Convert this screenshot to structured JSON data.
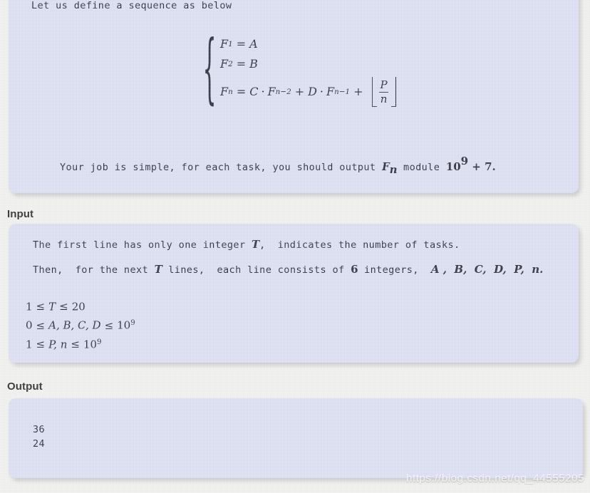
{
  "statement": {
    "intro": "Let us define a sequence as below",
    "formula": {
      "cases": [
        {
          "lhs": "F",
          "lhs_sub": "1",
          "eq": "=",
          "rhs": "A"
        },
        {
          "lhs": "F",
          "lhs_sub": "2",
          "eq": "=",
          "rhs": "B"
        },
        {
          "lhs": "F",
          "lhs_sub": "n",
          "eq": "=",
          "term1_coef": "C",
          "term1_var": "F",
          "term1_sub": "n−2",
          "plus1": "+",
          "term2_coef": "D",
          "term2_var": "F",
          "term2_sub": "n−1",
          "plus2": "+",
          "floor_num": "P",
          "floor_den": "n"
        }
      ],
      "brace": "{",
      "dot": "·"
    },
    "closing_pre": "Your job is simple, for each task, you should output ",
    "closing_var": "F",
    "closing_var_sub": "n",
    "closing_mid": " module ",
    "closing_base": "10",
    "closing_exp": "9",
    "closing_tail": " + 7."
  },
  "input": {
    "heading": "Input",
    "line1_pre": "The first line has only one integer ",
    "line1_var": "T",
    "line1_post": ",  indicates the number of tasks.",
    "line2_pre": "Then,  for the next ",
    "line2_var": "T",
    "line2_mid": " lines,  each line consists of ",
    "line2_count": "6",
    "line2_post": " integers,  ",
    "line2_vars": "A ,  B,  C,  D,  P,  n.",
    "constraints": [
      {
        "left": "1",
        "op1": "≤",
        "mid": "T",
        "op2": "≤",
        "right": "20",
        "right_exp": ""
      },
      {
        "left": "0",
        "op1": "≤",
        "mid": "A, B, C, D",
        "op2": "≤",
        "right": "10",
        "right_exp": "9"
      },
      {
        "left": "1",
        "op1": "≤",
        "mid": "P, n",
        "op2": "≤",
        "right": "10",
        "right_exp": "9"
      }
    ]
  },
  "output": {
    "heading": "Output",
    "lines": [
      "36",
      "24"
    ]
  },
  "watermark": "https://blog.csdn.net/qq_44555205",
  "colors": {
    "page_background": "#eeeeec",
    "panel_background": "#d8dbf0",
    "text": "#1b1b2b",
    "heading": "#1a1a1a"
  }
}
